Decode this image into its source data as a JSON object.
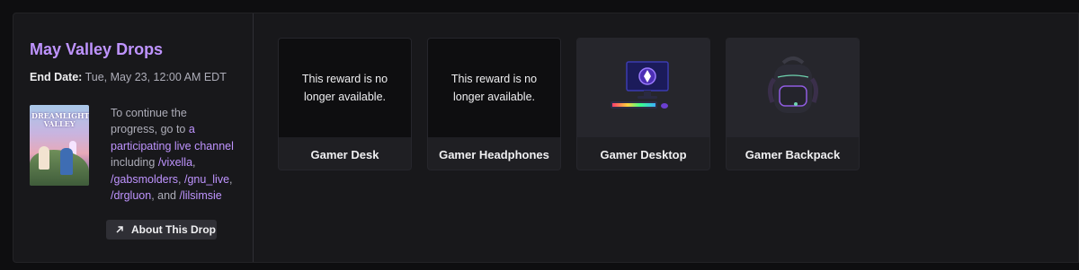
{
  "campaign": {
    "title": "May Valley Drops",
    "end_date_label": "End Date:",
    "end_date_value": "Tue, May 23, 12:00 AM EDT",
    "game_cover_text": "DREAMLIGHT VALLEY",
    "description": {
      "intro": "To continue the progress, go to ",
      "link_channel": "a participating live channel",
      "including": " including ",
      "channels": [
        "/vixella",
        "/gabsmolders",
        "/gnu_live",
        "/drgluon",
        "/lilsimsie"
      ],
      "sep": ", ",
      "and": "and "
    },
    "about_button": "About This Drop"
  },
  "rewards": [
    {
      "name": "Gamer Desk",
      "status": "This reward is no longer available.",
      "icon": "unavailable"
    },
    {
      "name": "Gamer Headphones",
      "status": "This reward is no longer available.",
      "icon": "unavailable"
    },
    {
      "name": "Gamer Desktop",
      "status": "",
      "icon": "desktop-computer-icon"
    },
    {
      "name": "Gamer Backpack",
      "status": "",
      "icon": "backpack-icon"
    }
  ],
  "colors": {
    "accent": "#bf94ff",
    "panel": "#18181b",
    "card": "#1f1f23"
  }
}
